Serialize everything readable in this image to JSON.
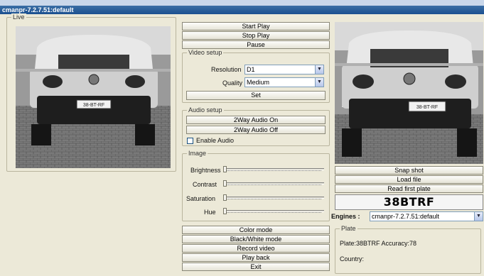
{
  "window": {
    "title": "cmanpr-7.2.7.51:default"
  },
  "live_panel": {
    "legend": "Live"
  },
  "playback": {
    "start_label": "Start Play",
    "stop_label": "Stop Play",
    "pause_label": "Pause"
  },
  "video_setup": {
    "legend": "Video setup",
    "resolution_label": "Resolution",
    "resolution_value": "D1",
    "quality_label": "Quality",
    "quality_value": "Medium",
    "set_label": "Set"
  },
  "audio_setup": {
    "legend": "Audio setup",
    "audio_on_label": "2Way Audio On",
    "audio_off_label": "2Way Audio Off",
    "enable_audio_label": "Enable Audio",
    "enable_audio_checked": false
  },
  "image": {
    "legend": "Image",
    "brightness_label": "Brightness",
    "contrast_label": "Contrast",
    "saturation_label": "Saturation",
    "hue_label": "Hue"
  },
  "bottom_buttons": {
    "color_mode": "Color mode",
    "bw_mode": "Black/White mode",
    "record_video": "Record video",
    "play_back": "Play back",
    "exit": "Exit"
  },
  "right_panel": {
    "snap_shot_label": "Snap shot",
    "load_file_label": "Load file",
    "read_plate_label": "Read first plate",
    "plate_text": "38BTRF",
    "engines_label": "Engines :",
    "engine_value": "cmanpr-7.2.7.51:default"
  },
  "plate_group": {
    "legend": "Plate",
    "result": "Plate:38BTRF Accuracy:78",
    "country_label": "Country:"
  },
  "car": {
    "plate_on_image": "38-BT-RF"
  },
  "colors": {
    "titlebar": "#1b4f8f",
    "window_bg": "#ece9d8",
    "video_bg": "#111111"
  }
}
